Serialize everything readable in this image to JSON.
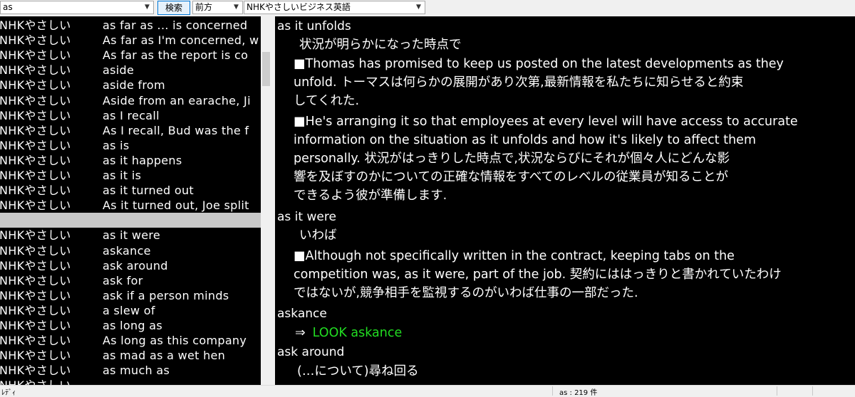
{
  "toolbar": {
    "search_value": "as",
    "search_button_label": "検索",
    "direction_value": "前方",
    "dictionary_value": "NHKやさしいビジネス英語"
  },
  "list": {
    "rows": [
      {
        "src": "NHKやさしい",
        "word": "as far as ... is concerned",
        "selected": false
      },
      {
        "src": "NHKやさしい",
        "word": "As far as I'm concerned, w",
        "selected": false
      },
      {
        "src": "NHKやさしい",
        "word": "As far as the report is co",
        "selected": false
      },
      {
        "src": "NHKやさしい",
        "word": "aside",
        "selected": false
      },
      {
        "src": "NHKやさしい",
        "word": "aside from",
        "selected": false
      },
      {
        "src": "NHKやさしい",
        "word": "Aside from an earache, Ji",
        "selected": false
      },
      {
        "src": "NHKやさしい",
        "word": "as I recall",
        "selected": false
      },
      {
        "src": "NHKやさしい",
        "word": "As I recall, Bud was the f",
        "selected": false
      },
      {
        "src": "NHKやさしい",
        "word": "as is",
        "selected": false
      },
      {
        "src": "NHKやさしい",
        "word": "as it happens",
        "selected": false
      },
      {
        "src": "NHKやさしい",
        "word": "as it is",
        "selected": false
      },
      {
        "src": "NHKやさしい",
        "word": "as it turned out",
        "selected": false
      },
      {
        "src": "NHKやさしい",
        "word": "As it turned out, Joe split",
        "selected": false
      },
      {
        "src": "",
        "word": "",
        "selected": true
      },
      {
        "src": "NHKやさしい",
        "word": "as it were",
        "selected": false
      },
      {
        "src": "NHKやさしい",
        "word": "askance",
        "selected": false
      },
      {
        "src": "NHKやさしい",
        "word": "ask around",
        "selected": false
      },
      {
        "src": "NHKやさしい",
        "word": "ask for",
        "selected": false
      },
      {
        "src": "NHKやさしい",
        "word": "ask if a person minds",
        "selected": false
      },
      {
        "src": "NHKやさしい",
        "word": "a slew of",
        "selected": false
      },
      {
        "src": "NHKやさしい",
        "word": "as long as",
        "selected": false
      },
      {
        "src": "NHKやさしい",
        "word": "As long as this company",
        "selected": false
      },
      {
        "src": "NHKやさしい",
        "word": "as mad as a wet hen",
        "selected": false
      },
      {
        "src": "NHKやさしい",
        "word": "as much as",
        "selected": false
      },
      {
        "src": "NHKやさしい",
        "word": "",
        "selected": false
      }
    ]
  },
  "definition": {
    "lines": [
      {
        "text": "as it unfolds",
        "cls": "headword"
      },
      {
        "text": "状況が明らかになった時点で",
        "cls": ""
      },
      {
        "text": "■Thomas has promised to keep us posted on the latest developments as they",
        "cls": ""
      },
      {
        "text": "unfold. トーマスは何らかの展開があり次第,最新情報を私たちに知らせると約束",
        "cls": ""
      },
      {
        "text": "してくれた.",
        "cls": ""
      },
      {
        "text": "■He's arranging it so that employees at every level will have access to accurate",
        "cls": ""
      },
      {
        "text": "information on the situation as it unfolds and how it's likely to affect them",
        "cls": ""
      },
      {
        "text": "personally. 状況がはっきりした時点で,状況ならびにそれが個々人にどんな影",
        "cls": ""
      },
      {
        "text": "響を及ぼすのかについての正確な情報をすべてのレベルの従業員が知ることが",
        "cls": ""
      },
      {
        "text": "できるよう彼が準備します.",
        "cls": ""
      },
      {
        "text": "as it were",
        "cls": "headword"
      },
      {
        "text": "いわば",
        "cls": ""
      },
      {
        "text": "■Although not specifically written in the contract, keeping tabs on the",
        "cls": ""
      },
      {
        "text": "competition was, as it were, part of the job. 契約にははっきりと書かれていたわけ",
        "cls": ""
      },
      {
        "text": "ではないが,競争相手を監視するのがいわば仕事の一部だった.",
        "cls": ""
      },
      {
        "text": "askance",
        "cls": "headword"
      },
      {
        "text": "⇒",
        "cls": "",
        "link": "LOOK askance"
      },
      {
        "text": "ask around",
        "cls": "headword"
      },
      {
        "text": "(…について)尋ね回る",
        "cls": ""
      },
      {
        "text": "",
        "cls": ""
      }
    ],
    "link_color": "#22dd22"
  },
  "status": {
    "left_text": "ﾚﾃﾞｨ",
    "count_text": "as : 219 件"
  },
  "icons": {
    "dropdown": "chevron-down-icon"
  }
}
